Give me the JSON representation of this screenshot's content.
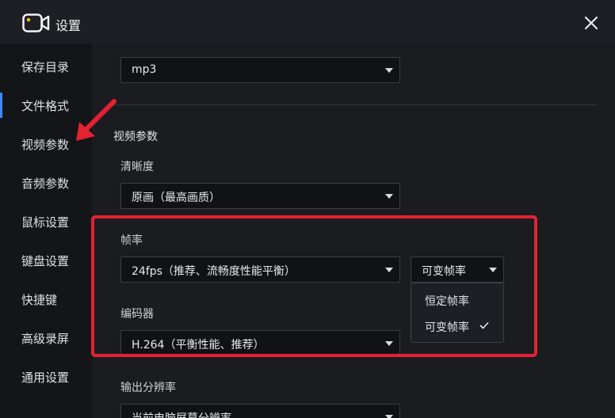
{
  "window": {
    "title": "设置"
  },
  "sidebar": {
    "items": [
      {
        "label": "保存目录"
      },
      {
        "label": "文件格式"
      },
      {
        "label": "视频参数"
      },
      {
        "label": "音频参数"
      },
      {
        "label": "鼠标设置"
      },
      {
        "label": "键盘设置"
      },
      {
        "label": "快捷键"
      },
      {
        "label": "高级录屏"
      },
      {
        "label": "通用设置"
      }
    ],
    "active_index": 1
  },
  "main": {
    "audio_format": {
      "value": "mp3"
    },
    "video_section_title": "视频参数",
    "clarity": {
      "label": "清晰度",
      "value": "原画（最高画质）"
    },
    "framerate": {
      "label": "帧率",
      "value": "24fps（推荐、流畅度性能平衡）"
    },
    "framerate_mode": {
      "value": "可变帧率",
      "options": [
        "恒定帧率",
        "可变帧率"
      ],
      "selected": "可变帧率"
    },
    "encoder": {
      "label": "编码器",
      "value": "H.264（平衡性能、推荐）"
    },
    "output_resolution": {
      "label": "输出分辨率",
      "value": "当前电脑屏幕分辨率"
    }
  },
  "colors": {
    "accent": "#3d8bff",
    "annotation_red": "#e32232"
  },
  "icons": {
    "app": "camera-icon",
    "close": "close-icon",
    "caret": "caret-down-icon",
    "check": "check-icon"
  }
}
